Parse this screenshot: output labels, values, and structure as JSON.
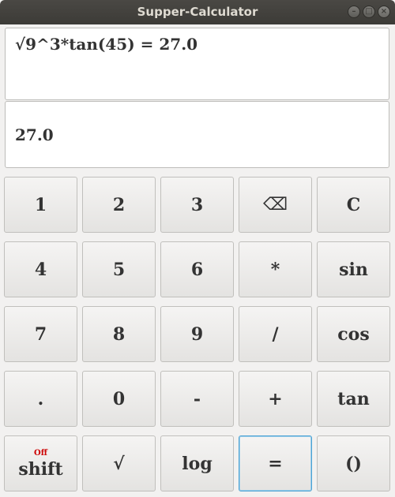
{
  "window": {
    "title": "Supper-Calculator",
    "controls": [
      "minimize",
      "maximize",
      "close"
    ]
  },
  "display": {
    "expression": "√9^3*tan(45) = 27.0",
    "result": "27.0"
  },
  "keys": {
    "k1": "1",
    "k2": "2",
    "k3": "3",
    "backspace": "⌫",
    "clear": "C",
    "k4": "4",
    "k5": "5",
    "k6": "6",
    "multiply": "*",
    "sin": "sin",
    "k7": "7",
    "k8": "8",
    "k9": "9",
    "divide": "/",
    "cos": "cos",
    "dot": ".",
    "k0": "0",
    "minus": "-",
    "plus": "+",
    "tan": "tan",
    "shift": "shift",
    "shift_state": "Off",
    "sqrt": "√",
    "log": "log",
    "equals": "=",
    "parens": "()"
  }
}
